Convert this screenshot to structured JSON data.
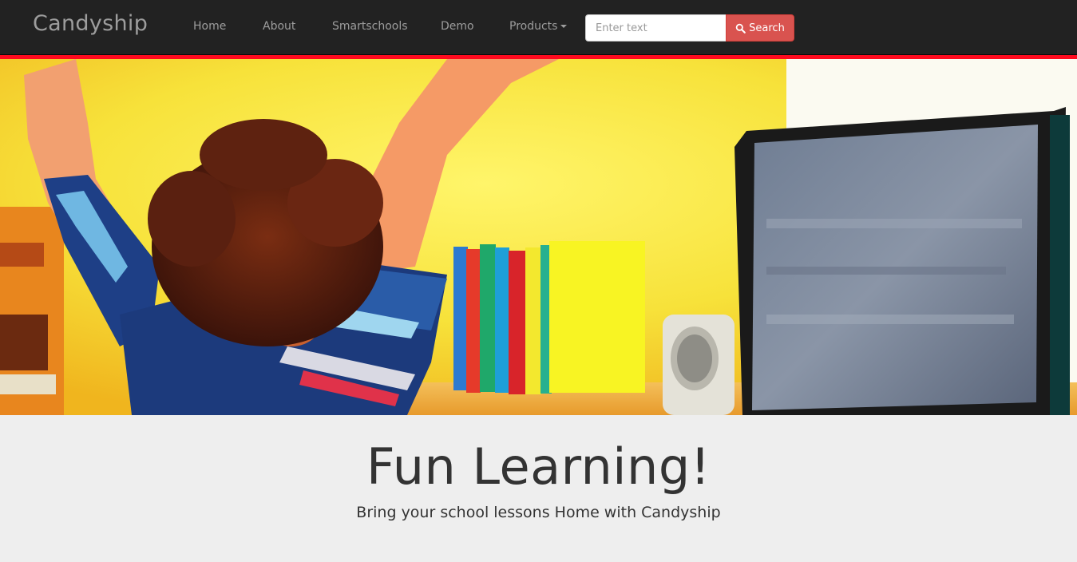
{
  "navbar": {
    "brand": "Candyship",
    "links": [
      "Home",
      "About",
      "Smartschools",
      "Demo",
      "Products"
    ],
    "search": {
      "placeholder": "Enter text",
      "button_label": "Search"
    }
  },
  "hero": {
    "image": "child-cheering-at-computer-photo"
  },
  "jumbotron": {
    "headline": "Fun Learning!",
    "subline": "Bring your school lessons Home with Candyship"
  },
  "colors": {
    "navbar_bg": "#222222",
    "accent_red": "#ff0a1e",
    "search_button": "#d9534f",
    "page_bg": "#eeeeee"
  }
}
